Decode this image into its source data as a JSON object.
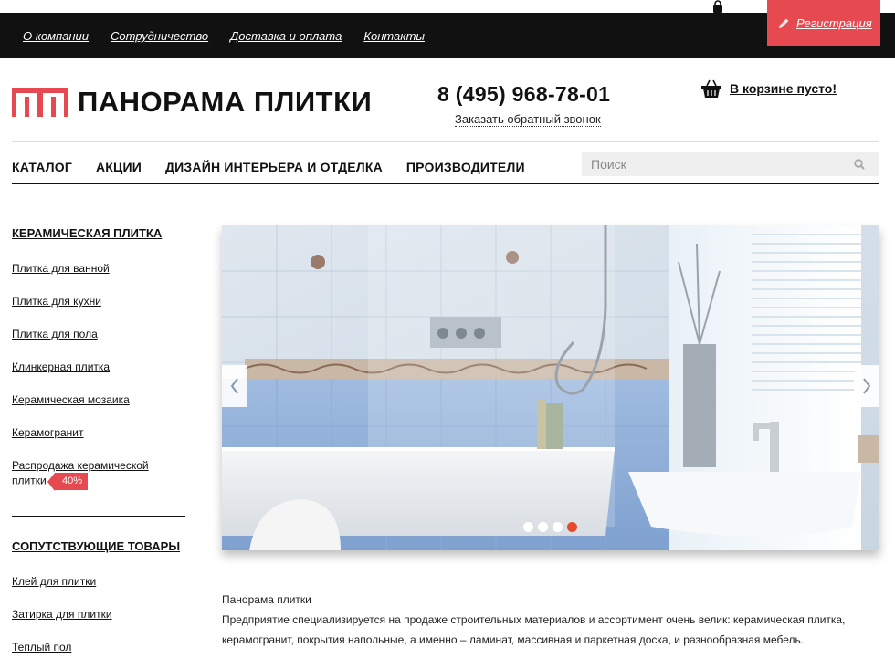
{
  "topbar": {
    "nav": [
      "О компании",
      "Сотрудничество",
      "Доставка и оплата",
      "Контакты"
    ],
    "login_label": "Вход",
    "register_label": "Регистрация"
  },
  "header": {
    "logo_text": "ПАНОРАМА ПЛИТКИ",
    "phone": "8 (495) 968-78-01",
    "callback_label": "Заказать обратный звонок",
    "cart_label": "В корзине пусто!"
  },
  "mainnav": {
    "items": [
      "КАТАЛОГ",
      "АКЦИИ",
      "ДИЗАЙН ИНТЕРЬЕРА И ОТДЕЛКА",
      "ПРОИЗВОДИТЕЛИ"
    ],
    "search_placeholder": "Поиск"
  },
  "sidebar": {
    "section1_title": "КЕРАМИЧЕСКАЯ ПЛИТКА",
    "section1_items": [
      "Плитка для ванной",
      "Плитка для кухни",
      "Плитка для пола",
      "Клинкерная плитка",
      "Керамическая мозаика",
      "Керамогранит"
    ],
    "sale_line1": "Распродажа керамической",
    "sale_line2": "плитки",
    "sale_badge": "40%",
    "section2_title": "СОПУТСТВУЮЩИЕ ТОВАРЫ",
    "section2_items": [
      "Клей для плитки",
      "Затирка для плитки",
      "Теплый пол"
    ]
  },
  "slider": {
    "slide_count": 4,
    "active_slide": 4
  },
  "content": {
    "title": "Панорама плитки",
    "text": "Предприятие специализируется на продаже строительных материалов и ассортимент очень велик: керамическая плитка, керамогранит, покрытия напольные, а именно – ламинат, массивная и паркетная доска, и разнообразная мебель."
  },
  "colors": {
    "accent": "#e64a50",
    "topbar": "#111111",
    "active_dot": "#e64a2a"
  }
}
